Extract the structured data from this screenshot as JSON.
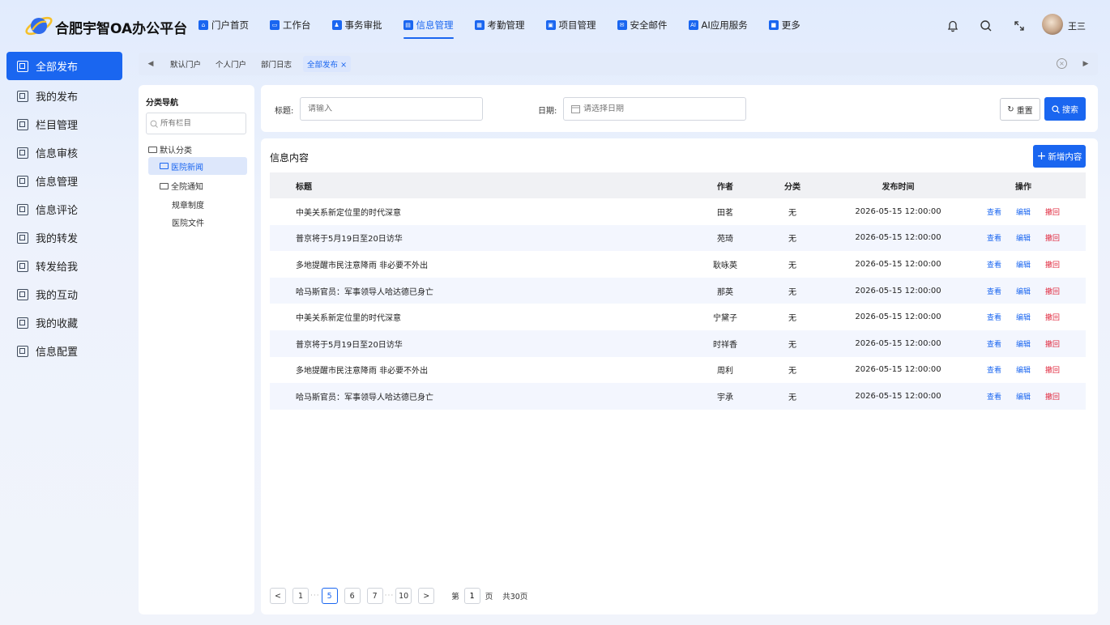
{
  "app": {
    "title": "合肥宇智OA办公平台"
  },
  "nav": [
    {
      "label": "门户首页",
      "icon": "home-icon"
    },
    {
      "label": "工作台",
      "icon": "workbench-icon"
    },
    {
      "label": "事务审批",
      "icon": "approval-icon"
    },
    {
      "label": "信息管理",
      "icon": "info-icon",
      "active": true
    },
    {
      "label": "考勤管理",
      "icon": "attendance-icon"
    },
    {
      "label": "项目管理",
      "icon": "project-icon"
    },
    {
      "label": "安全邮件",
      "icon": "mail-icon"
    },
    {
      "label": "AI应用服务",
      "icon": "ai-icon"
    },
    {
      "label": "更多",
      "icon": "more-icon"
    }
  ],
  "header": {
    "user": "王三"
  },
  "sidebar": {
    "items": [
      {
        "label": "全部发布",
        "active": true
      },
      {
        "label": "我的发布"
      },
      {
        "label": "栏目管理"
      },
      {
        "label": "信息审核"
      },
      {
        "label": "信息管理"
      },
      {
        "label": "信息评论"
      },
      {
        "label": "我的转发"
      },
      {
        "label": "转发给我"
      },
      {
        "label": "我的互动"
      },
      {
        "label": "我的收藏"
      },
      {
        "label": "信息配置"
      }
    ]
  },
  "tabs": {
    "items": [
      {
        "label": "默认门户"
      },
      {
        "label": "个人门户"
      },
      {
        "label": "部门日志"
      },
      {
        "label": "全部发布 ×",
        "active": true
      }
    ]
  },
  "category": {
    "title": "分类导航",
    "search_placeholder": "所有栏目",
    "tree": [
      {
        "label": "默认分类"
      },
      {
        "label": "医院新闻",
        "selected": true
      },
      {
        "label": "全院通知"
      },
      {
        "label": "规章制度"
      },
      {
        "label": "医院文件"
      }
    ]
  },
  "search": {
    "title_label": "标题:",
    "title_placeholder": "请输入",
    "date_label": "日期:",
    "date_placeholder": "请选择日期",
    "reset_label": "重置",
    "search_label": "搜索"
  },
  "content": {
    "title": "信息内容",
    "add_label": "新增内容",
    "columns": [
      "标题",
      "作者",
      "分类",
      "发布时间",
      "操作"
    ],
    "actions": {
      "view": "查看",
      "edit": "编辑",
      "recall": "撤回"
    },
    "rows": [
      {
        "title": "中美关系新定位里的时代深意",
        "author": "田茗",
        "category": "无",
        "time": "2026-05-15 12:00:00"
      },
      {
        "title": "普京将于5月19日至20日访华",
        "author": "苑琦",
        "category": "无",
        "time": "2026-05-15 12:00:00"
      },
      {
        "title": "多地提醒市民注意降雨 非必要不外出",
        "author": "耿咏英",
        "category": "无",
        "time": "2026-05-15 12:00:00"
      },
      {
        "title": "哈马斯官员：军事领导人哈达德已身亡",
        "author": "那英",
        "category": "无",
        "time": "2026-05-15 12:00:00"
      },
      {
        "title": "中美关系新定位里的时代深意",
        "author": "宁黛子",
        "category": "无",
        "time": "2026-05-15 12:00:00"
      },
      {
        "title": "普京将于5月19日至20日访华",
        "author": "时祥香",
        "category": "无",
        "time": "2026-05-15 12:00:00"
      },
      {
        "title": "多地提醒市民注意降雨 非必要不外出",
        "author": "周利",
        "category": "无",
        "time": "2026-05-15 12:00:00"
      },
      {
        "title": "哈马斯官员：军事领导人哈达德已身亡",
        "author": "宇承",
        "category": "无",
        "time": "2026-05-15 12:00:00"
      }
    ]
  },
  "pagination": {
    "prev": "<",
    "next": ">",
    "pages": [
      "1",
      "5",
      "6",
      "7",
      "10"
    ],
    "dots": "···",
    "current": "5",
    "goto_prefix": "第",
    "goto_value": "1",
    "goto_suffix": "页",
    "total": "共30页"
  },
  "colors": {
    "primary": "#1a66f0",
    "danger": "#e0263b"
  }
}
